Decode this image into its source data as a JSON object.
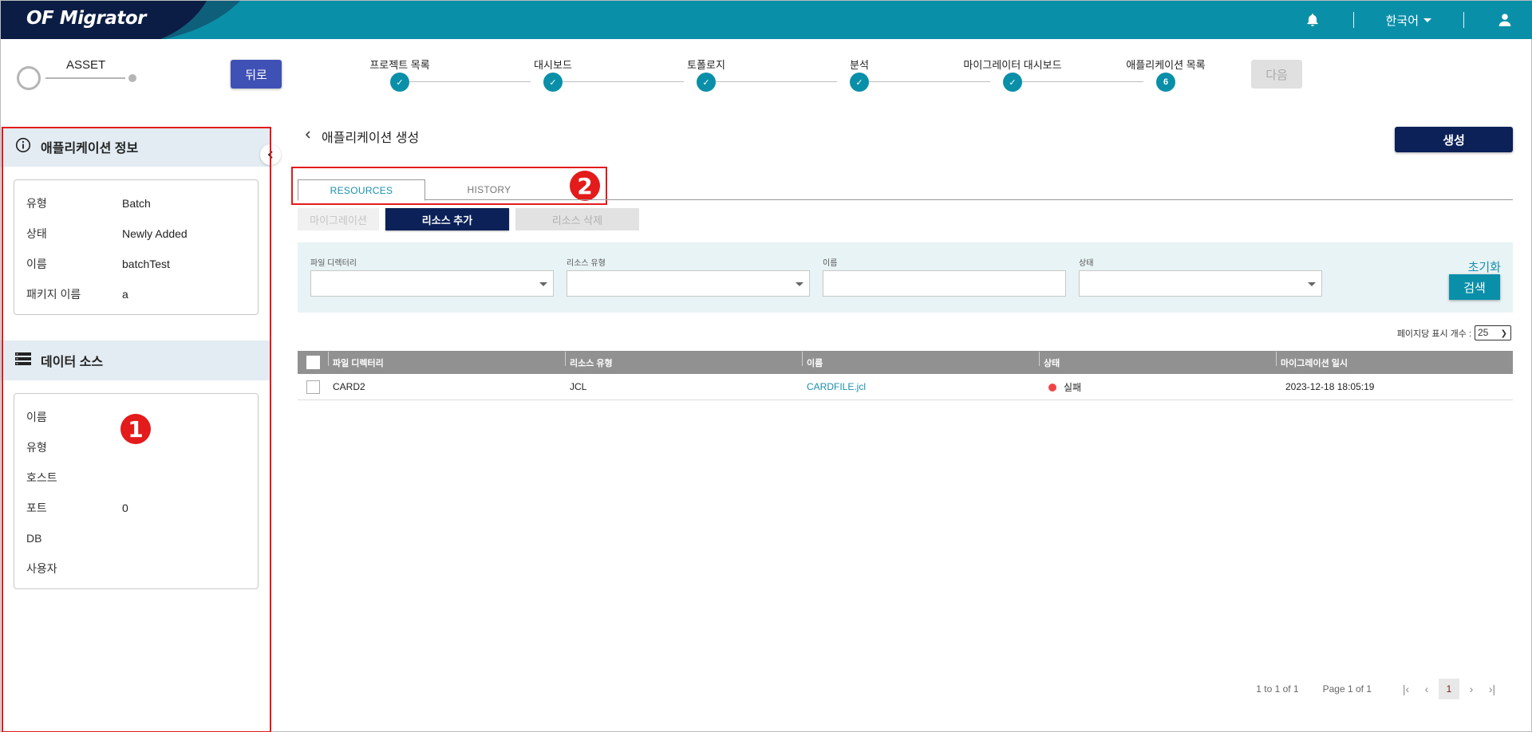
{
  "header": {
    "app_name": "OF Migrator",
    "language": "한국어",
    "icons": [
      "bell-icon",
      "user-icon"
    ],
    "colors": {
      "primary": "#0a8fa9",
      "dark_navy": "#0b1d44"
    }
  },
  "stepper": {
    "asset_label": "ASSET",
    "back_label": "뒤로",
    "next_label": "다음",
    "steps": [
      {
        "label": "프로젝트 목록",
        "state": "done",
        "icon": "✓"
      },
      {
        "label": "대시보드",
        "state": "done",
        "icon": "✓"
      },
      {
        "label": "토폴로지",
        "state": "done",
        "icon": "✓"
      },
      {
        "label": "분석",
        "state": "done",
        "icon": "✓"
      },
      {
        "label": "마이그레이터 대시보드",
        "state": "done",
        "icon": "✓"
      },
      {
        "label": "애플리케이션 목록",
        "state": "current",
        "icon": "6"
      }
    ]
  },
  "left_panel": {
    "app_info": {
      "title": "애플리케이션 정보",
      "rows": [
        {
          "key": "유형",
          "value": "Batch"
        },
        {
          "key": "상태",
          "value": "Newly Added"
        },
        {
          "key": "이름",
          "value": "batchTest"
        },
        {
          "key": "패키지 이름",
          "value": "a"
        }
      ]
    },
    "data_source": {
      "title": "데이터 소스",
      "rows": [
        {
          "key": "이름",
          "value": ""
        },
        {
          "key": "유형",
          "value": ""
        },
        {
          "key": "호스트",
          "value": ""
        },
        {
          "key": "포트",
          "value": "0"
        },
        {
          "key": "DB",
          "value": ""
        },
        {
          "key": "사용자",
          "value": ""
        }
      ]
    }
  },
  "annotations": {
    "badge1": "1",
    "badge2": "2"
  },
  "main": {
    "title": "애플리케이션 생성",
    "create_label": "생성",
    "tabs": [
      {
        "label": "RESOURCES",
        "active": true
      },
      {
        "label": "HISTORY",
        "active": false
      }
    ],
    "actions": {
      "migrate": "마이그레이션",
      "add_resource": "리소스 추가",
      "delete_resource": "리소스 삭제"
    },
    "filter": {
      "file_dir_label": "파일 디렉터리",
      "resource_type_label": "리소스 유형",
      "name_label": "이름",
      "status_label": "상태",
      "file_dir_value": "",
      "resource_type_value": "",
      "name_value": "",
      "status_value": "",
      "reset_label": "초기화",
      "search_label": "검색"
    },
    "per_page_label": "페이지당 표시 개수 :",
    "per_page_value": "25",
    "grid": {
      "columns": [
        "파일 디렉터리",
        "리소스 유형",
        "이름",
        "상태",
        "마이그레이션 일시"
      ],
      "rows": [
        {
          "dir": "CARD2",
          "type": "JCL",
          "name": "CARDFILE.jcl",
          "status": "실패",
          "status_color": "#f04545",
          "date": "2023-12-18 18:05:19"
        }
      ]
    },
    "pager": {
      "summary": "1 to 1 of 1",
      "page_info": "Page 1 of 1",
      "current_page": "1"
    }
  }
}
